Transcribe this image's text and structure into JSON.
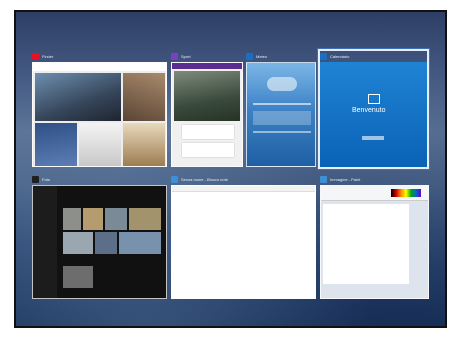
{
  "task_view": {
    "windows": [
      {
        "title": "Finder",
        "icon": "news-icon",
        "icon_color": "#e81123"
      },
      {
        "title": "Sport",
        "icon": "sport-icon",
        "icon_color": "#7b3fc4"
      },
      {
        "title": "Meteo",
        "icon": "weather-icon",
        "icon_color": "#1b6ec2"
      },
      {
        "title": "Calendario",
        "icon": "calendar-icon",
        "icon_color": "#1b6ec2",
        "welcome_text": "Benvenuto"
      },
      {
        "title": "Foto",
        "icon": "photos-icon",
        "icon_color": "#1f1f1f"
      },
      {
        "title": "Senza nome - Blocco note",
        "icon": "notepad-icon",
        "icon_color": "#3d8fd6"
      },
      {
        "title": "Immagine - Paint",
        "icon": "paint-icon",
        "icon_color": "#3d8fd6"
      }
    ]
  }
}
